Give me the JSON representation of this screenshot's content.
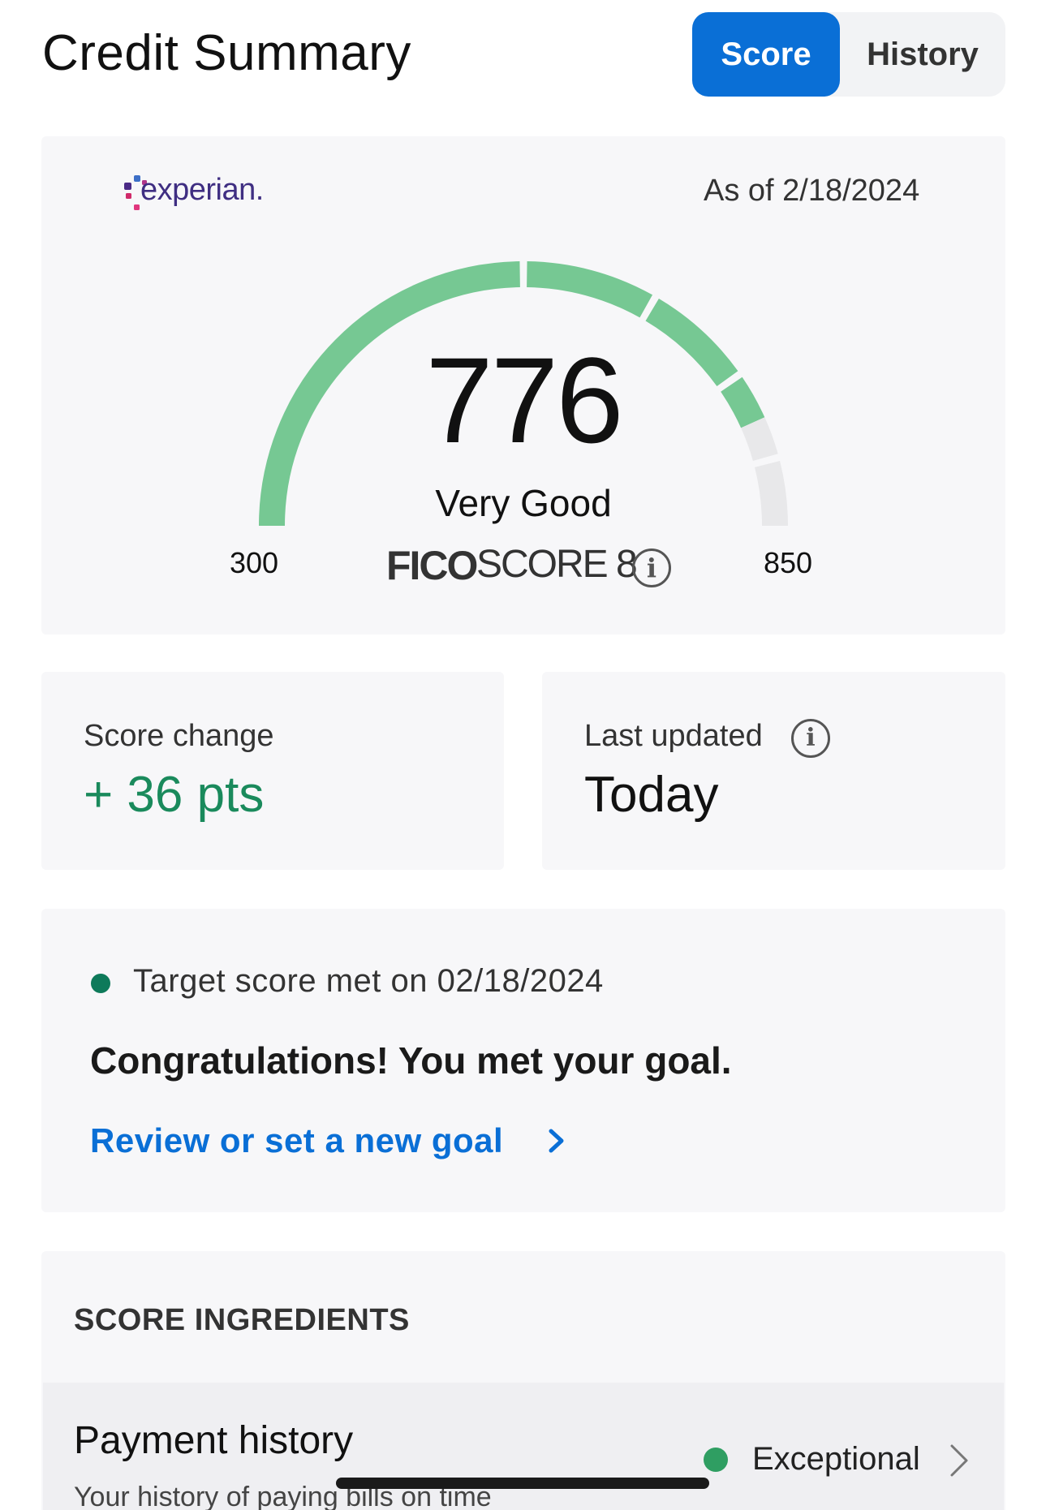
{
  "header": {
    "title": "Credit Summary",
    "tabs": [
      {
        "label": "Score",
        "active": true
      },
      {
        "label": "History",
        "active": false
      }
    ]
  },
  "score_card": {
    "bureau": "experian.",
    "as_of": "As of 2/18/2024",
    "score": "776",
    "score_value": 776,
    "rating": "Very Good",
    "scale_min": "300",
    "scale_max": "850",
    "model_brand": "FICO",
    "model_name": "SCORE 8",
    "colors": {
      "filled": "#76c893",
      "empty": "#e8e8ea"
    }
  },
  "score_change": {
    "label": "Score change",
    "value": "+ 36 pts"
  },
  "last_updated": {
    "label": "Last updated",
    "value": "Today"
  },
  "goal": {
    "status": "Target score met on 02/18/2024",
    "message": "Congratulations! You met your goal.",
    "link": "Review or set a new goal"
  },
  "ingredients": {
    "heading": "SCORE INGREDIENTS",
    "items": [
      {
        "name": "Payment history",
        "description": "Your history of paying bills on time",
        "rating": "Exceptional"
      }
    ]
  },
  "colors": {
    "accent": "#0a6fd6",
    "positive": "#1a8a5c",
    "status_dot": "#0e7a5a"
  }
}
